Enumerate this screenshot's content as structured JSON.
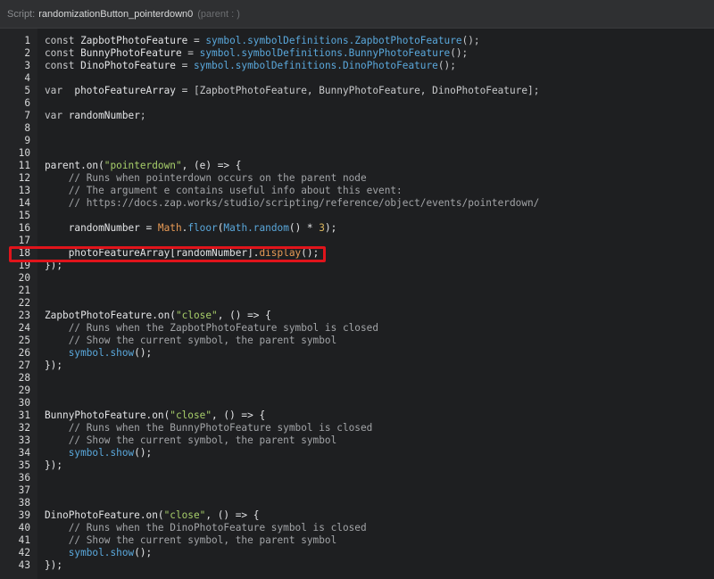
{
  "header": {
    "label": "Script:",
    "script_name": "randomizationButton_pointerdown0",
    "parent_label": "(parent : )"
  },
  "code": {
    "highlighted_line": 18,
    "lines": [
      [
        [
          "kw",
          "const "
        ],
        [
          "id",
          "ZapbotPhotoFeature"
        ],
        [
          "kw",
          " = "
        ],
        [
          "blue",
          "symbol.symbolDefinitions.ZapbotPhotoFeature"
        ],
        [
          "kw",
          "();"
        ]
      ],
      [
        [
          "kw",
          "const "
        ],
        [
          "id",
          "BunnyPhotoFeature"
        ],
        [
          "kw",
          " = "
        ],
        [
          "blue",
          "symbol.symbolDefinitions.BunnyPhotoFeature"
        ],
        [
          "kw",
          "();"
        ]
      ],
      [
        [
          "kw",
          "const "
        ],
        [
          "id",
          "DinoPhotoFeature"
        ],
        [
          "kw",
          " = "
        ],
        [
          "blue",
          "symbol.symbolDefinitions.DinoPhotoFeature"
        ],
        [
          "kw",
          "();"
        ]
      ],
      [],
      [
        [
          "kw",
          "var  "
        ],
        [
          "id",
          "photoFeatureArray"
        ],
        [
          "kw",
          " = [ZapbotPhotoFeature, BunnyPhotoFeature, DinoPhotoFeature];"
        ]
      ],
      [],
      [
        [
          "kw",
          "var "
        ],
        [
          "id",
          "randomNumber"
        ],
        [
          "kw",
          ";"
        ]
      ],
      [],
      [],
      [],
      [
        [
          "id",
          "parent.on("
        ],
        [
          "str",
          "\"pointerdown\""
        ],
        [
          "id",
          ", (e) => {"
        ]
      ],
      [
        [
          "cm",
          "    // Runs when pointerdown occurs on the parent node"
        ]
      ],
      [
        [
          "cm",
          "    // The argument e contains useful info about this event:"
        ]
      ],
      [
        [
          "cm",
          "    // https://docs.zap.works/studio/scripting/reference/object/events/pointerdown/"
        ]
      ],
      [],
      [
        [
          "id",
          "    randomNumber = "
        ],
        [
          "fn",
          "Math"
        ],
        [
          "id",
          "."
        ],
        [
          "blue",
          "floor"
        ],
        [
          "id",
          "("
        ],
        [
          "blue",
          "Math.random"
        ],
        [
          "id",
          "() * "
        ],
        [
          "num",
          "3"
        ],
        [
          "id",
          ");"
        ]
      ],
      [],
      [
        [
          "id",
          "    photoFeatureArray[randomNumber]."
        ],
        [
          "fn",
          "display"
        ],
        [
          "id",
          "();"
        ]
      ],
      [
        [
          "id",
          "});"
        ]
      ],
      [],
      [],
      [],
      [
        [
          "id",
          "ZapbotPhotoFeature.on("
        ],
        [
          "str",
          "\"close\""
        ],
        [
          "id",
          ", () => {"
        ]
      ],
      [
        [
          "cm",
          "    // Runs when the ZapbotPhotoFeature symbol is closed"
        ]
      ],
      [
        [
          "cm",
          "    // Show the current symbol, the parent symbol"
        ]
      ],
      [
        [
          "blue",
          "    symbol.show"
        ],
        [
          "id",
          "();"
        ]
      ],
      [
        [
          "id",
          "});"
        ]
      ],
      [],
      [],
      [],
      [
        [
          "id",
          "BunnyPhotoFeature.on("
        ],
        [
          "str",
          "\"close\""
        ],
        [
          "id",
          ", () => {"
        ]
      ],
      [
        [
          "cm",
          "    // Runs when the BunnyPhotoFeature symbol is closed"
        ]
      ],
      [
        [
          "cm",
          "    // Show the current symbol, the parent symbol"
        ]
      ],
      [
        [
          "blue",
          "    symbol.show"
        ],
        [
          "id",
          "();"
        ]
      ],
      [
        [
          "id",
          "});"
        ]
      ],
      [],
      [],
      [],
      [
        [
          "id",
          "DinoPhotoFeature.on("
        ],
        [
          "str",
          "\"close\""
        ],
        [
          "id",
          ", () => {"
        ]
      ],
      [
        [
          "cm",
          "    // Runs when the DinoPhotoFeature symbol is closed"
        ]
      ],
      [
        [
          "cm",
          "    // Show the current symbol, the parent symbol"
        ]
      ],
      [
        [
          "blue",
          "    symbol.show"
        ],
        [
          "id",
          "();"
        ]
      ],
      [
        [
          "id",
          "});"
        ]
      ]
    ]
  }
}
